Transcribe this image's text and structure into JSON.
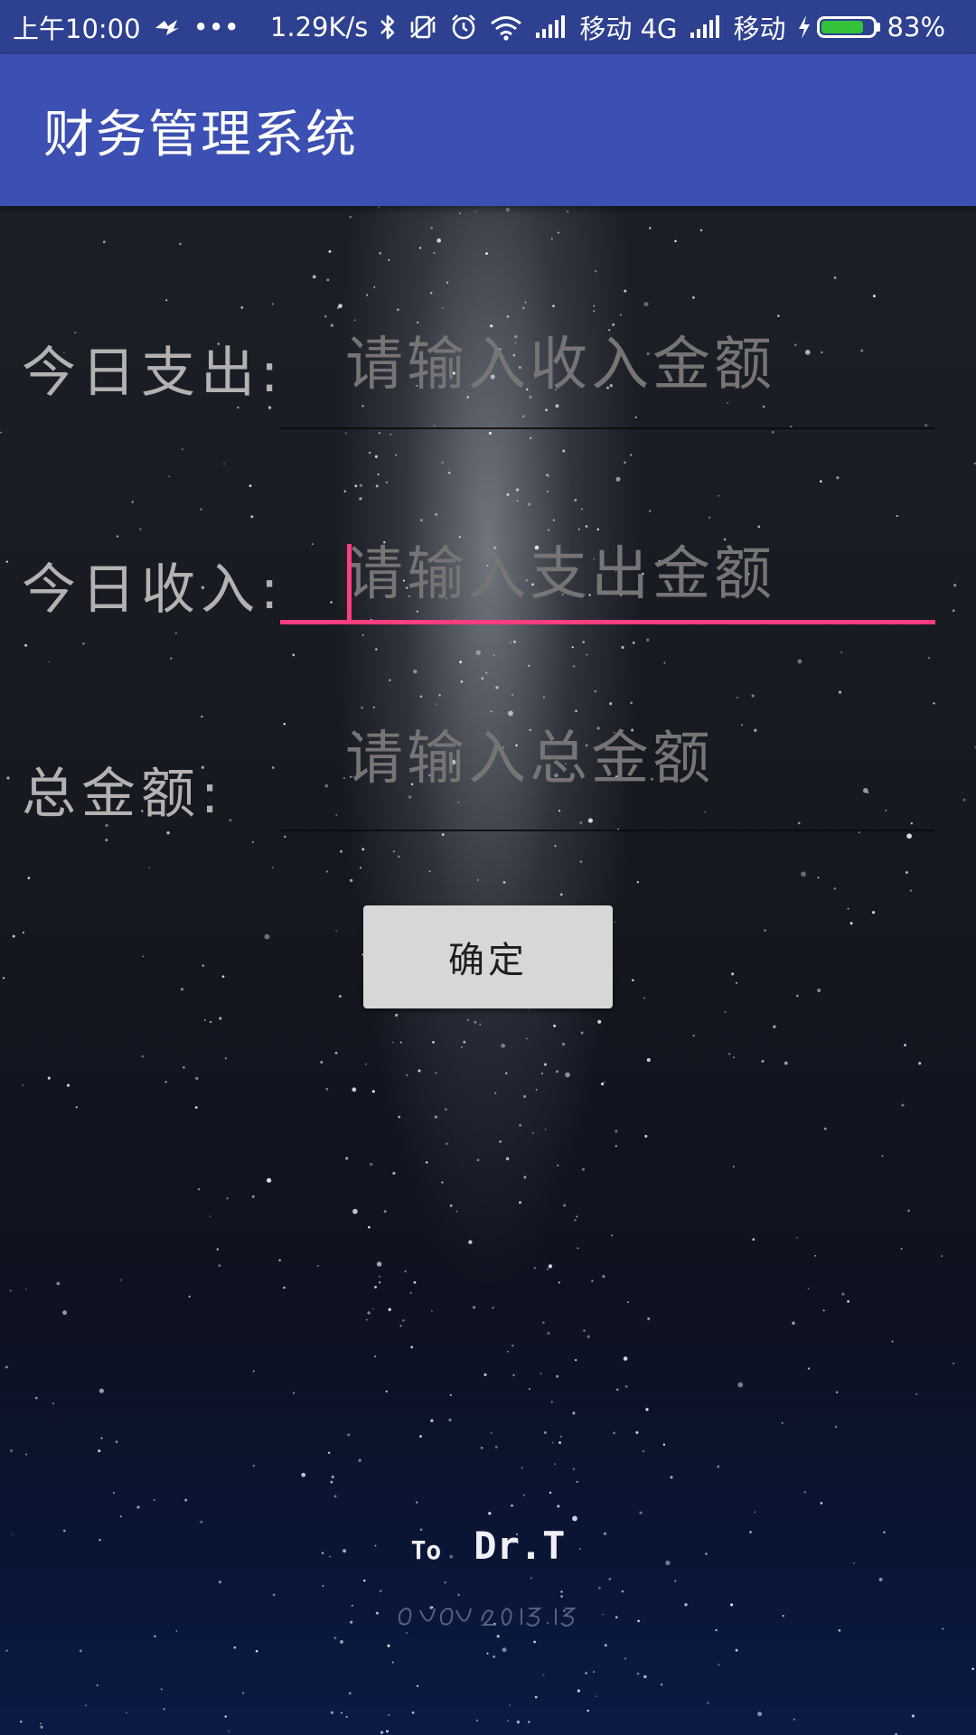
{
  "status_bar": {
    "time": "上午10:00",
    "dots": "•••",
    "net_speed": "1.29K/s",
    "carrier1": "移动 4G",
    "carrier2": "移动",
    "battery_percent": "83%",
    "battery_level": 0.83,
    "battery_color": "#34c23b",
    "icons": [
      "notification-icon",
      "bluetooth-icon",
      "vibrate-off-icon",
      "alarm-icon",
      "wifi-icon",
      "signal-icon",
      "signal-icon",
      "charging-icon",
      "battery-icon"
    ]
  },
  "app_bar": {
    "title": "财务管理系统",
    "color": "#3c4fb3"
  },
  "form": {
    "expense": {
      "label": "今日支出:",
      "placeholder": "请输入收入金额",
      "value": ""
    },
    "income": {
      "label": "今日收入:",
      "placeholder": "请输入支出金额",
      "value": "",
      "focused": true
    },
    "total": {
      "label": "总金额:",
      "placeholder": "请输入总金额",
      "value": ""
    },
    "accent_color": "#ff3d7f"
  },
  "confirm_button": {
    "label": "确定"
  },
  "footer": {
    "to": "To",
    "name": "Dr.T"
  }
}
